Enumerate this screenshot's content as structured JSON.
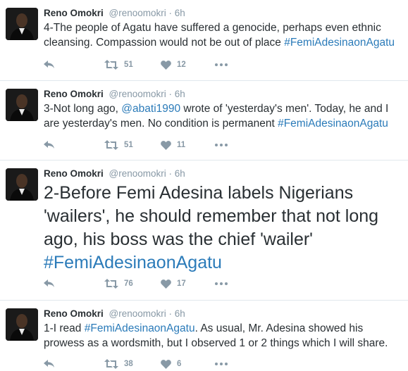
{
  "colors": {
    "link": "#2b7bb9",
    "meta": "#8899a6",
    "text": "#292f33",
    "divider": "#e1e8ed"
  },
  "icons": {
    "reply": "reply-icon",
    "retweet": "retweet-icon",
    "like": "heart-icon",
    "more": "more-dots-icon"
  },
  "tweets": [
    {
      "name": "Reno Omokri",
      "handle": "@renoomokri",
      "sep": "·",
      "time": "6h",
      "segments": [
        {
          "type": "text",
          "value": "4-The people of Agatu have suffered a genocide, perhaps even ethnic cleansing. Compassion would not be out of place "
        },
        {
          "type": "hashtag",
          "value": "#FemiAdesinaonAgatu"
        }
      ],
      "retweets": "51",
      "likes": "12"
    },
    {
      "name": "Reno Omokri",
      "handle": "@renoomokri",
      "sep": "·",
      "time": "6h",
      "segments": [
        {
          "type": "text",
          "value": "3-Not long ago, "
        },
        {
          "type": "mention",
          "value": "@abati1990"
        },
        {
          "type": "text",
          "value": " wrote of 'yesterday's men'. Today, he and I are yesterday's men. No condition is permanent "
        },
        {
          "type": "hashtag",
          "value": "#FemiAdesinaonAgatu"
        }
      ],
      "retweets": "51",
      "likes": "11"
    },
    {
      "name": "Reno Omokri",
      "handle": "@renoomokri",
      "sep": "·",
      "time": "6h",
      "segments": [
        {
          "type": "text",
          "value": "2-Before Femi Adesina labels Nigerians 'wailers', he should remember that not long ago, his boss was the chief 'wailer' "
        },
        {
          "type": "hashtag",
          "value": "#FemiAdesinaonAgatu"
        }
      ],
      "retweets": "76",
      "likes": "17"
    },
    {
      "name": "Reno Omokri",
      "handle": "@renoomokri",
      "sep": "·",
      "time": "6h",
      "segments": [
        {
          "type": "text",
          "value": "1-I read "
        },
        {
          "type": "hashtag",
          "value": "#FemiAdesinaonAgatu"
        },
        {
          "type": "text",
          "value": ". As usual, Mr. Adesina showed his prowess as a wordsmith, but I observed 1 or 2 things which I will share."
        }
      ],
      "retweets": "38",
      "likes": "6"
    }
  ]
}
